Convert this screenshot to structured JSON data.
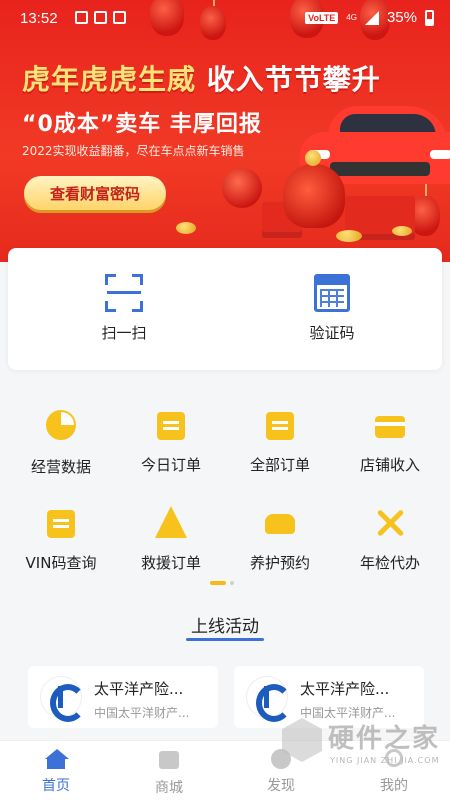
{
  "status_bar": {
    "time": "13:52",
    "volte": "VoLTE",
    "network": "4G",
    "battery": "35%"
  },
  "banner": {
    "headline_part1": "虎年虎虎生威 ",
    "headline_part2": "收入节节攀升",
    "subheadline": "“0成本”卖车 丰厚回报",
    "caption": "2022实现收益翻番，尽在车点点新车销售",
    "button_label": "查看财富密码"
  },
  "quick_actions": [
    {
      "label": "扫一扫",
      "icon": "scan-icon"
    },
    {
      "label": "验证码",
      "icon": "calculator-icon"
    }
  ],
  "functions": [
    {
      "label": "经营数据",
      "icon": "pie-chart-icon"
    },
    {
      "label": "今日订单",
      "icon": "calendar-icon"
    },
    {
      "label": "全部订单",
      "icon": "clipboard-icon"
    },
    {
      "label": "店铺收入",
      "icon": "card-icon"
    },
    {
      "label": "VIN码查询",
      "icon": "box-icon"
    },
    {
      "label": "救援订单",
      "icon": "cone-icon"
    },
    {
      "label": "养护预约",
      "icon": "car-icon"
    },
    {
      "label": "年检代办",
      "icon": "tools-icon"
    }
  ],
  "section": {
    "title": "上线活动"
  },
  "activities": [
    {
      "name": "太平洋产险...",
      "desc": "中国太平洋财产..."
    },
    {
      "name": "太平洋产险...",
      "desc": "中国太平洋财产..."
    }
  ],
  "bottom_nav": [
    {
      "label": "首页",
      "active": true
    },
    {
      "label": "商城",
      "active": false
    },
    {
      "label": "发现",
      "active": false
    },
    {
      "label": "我的",
      "active": false
    }
  ],
  "watermark": {
    "title": "硬件之家",
    "subtitle": "YING JIAN ZHI JIA.COM"
  },
  "colors": {
    "accent": "#3c72d8",
    "banner_red": "#e8231d",
    "icon_yellow": "#f8c21c"
  }
}
